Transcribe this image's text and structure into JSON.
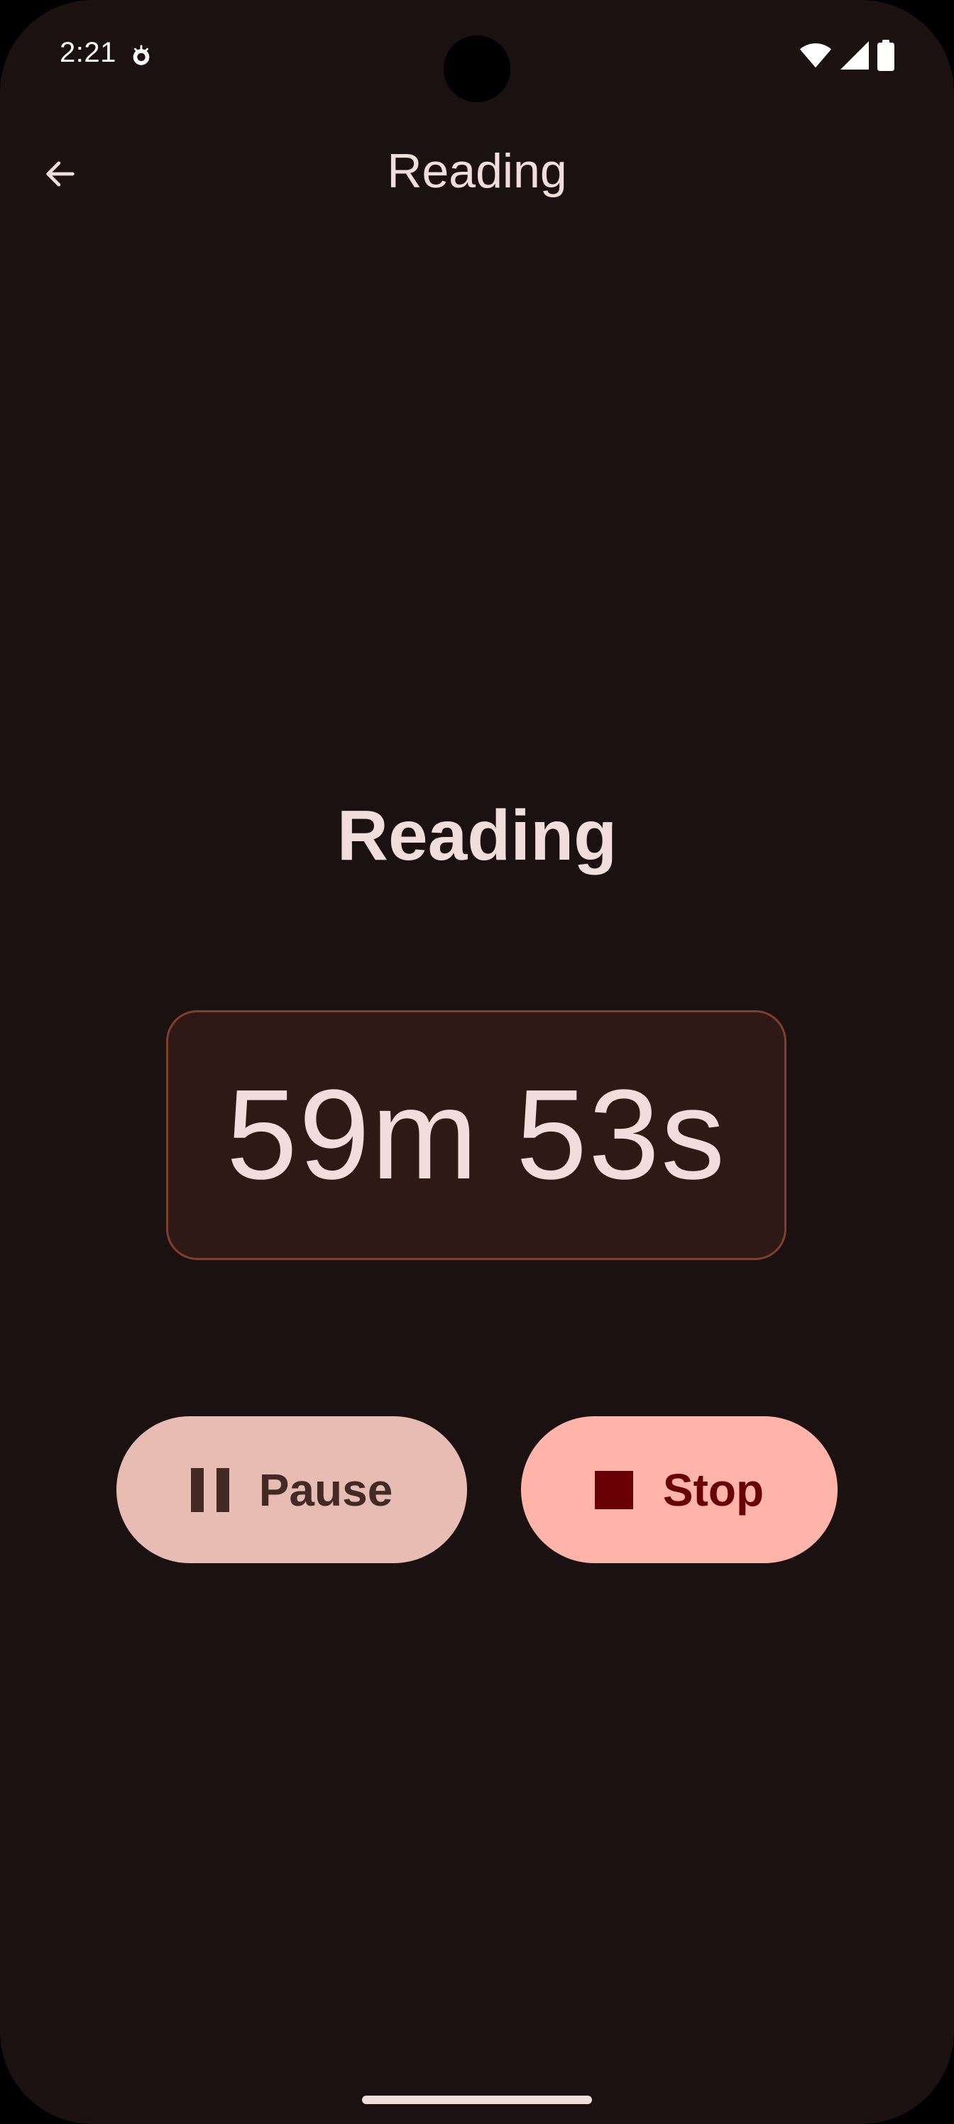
{
  "status_bar": {
    "time": "2:21",
    "notification_icon": "app-notification-icon",
    "wifi_icon": "wifi-icon",
    "signal_icon": "cell-signal-icon",
    "battery_icon": "battery-icon"
  },
  "top_bar": {
    "back_icon": "arrow-back-icon",
    "title": "Reading"
  },
  "main": {
    "activity_title": "Reading",
    "timer": "59m 53s"
  },
  "actions": {
    "pause_label": "Pause",
    "pause_icon": "pause-icon",
    "stop_label": "Stop",
    "stop_icon": "stop-icon"
  },
  "colors": {
    "background": "#1a1110",
    "on_surface": "#f1dedc",
    "timer_card_bg": "#2e1915",
    "timer_card_border": "#7e3f2e",
    "pause_button_bg": "#e7bdb3",
    "pause_button_fg": "#442a24",
    "stop_button_bg": "#ffb4aa",
    "stop_button_fg": "#690005"
  }
}
